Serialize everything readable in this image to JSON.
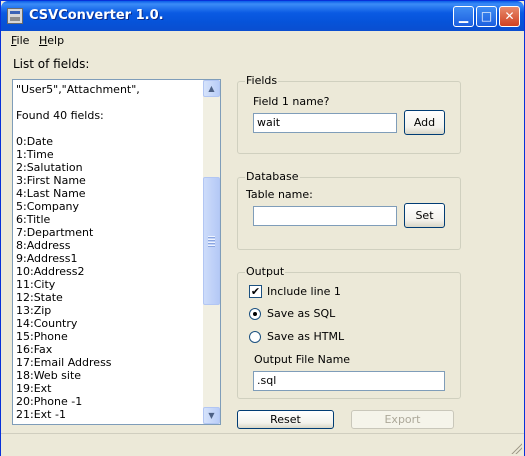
{
  "window": {
    "title": "CSVConverter 1.0."
  },
  "menu": [
    {
      "label": "File",
      "accel": "F",
      "rest": "ile"
    },
    {
      "label": "Help",
      "accel": "H",
      "rest": "elp"
    }
  ],
  "fields_list": {
    "label": "List of fields:",
    "lines": [
      "\"User5\",\"Attachment\",",
      "",
      "Found 40 fields:",
      "",
      "0:Date",
      "1:Time",
      "2:Salutation",
      "3:First Name",
      "4:Last Name",
      "5:Company",
      "6:Title",
      "7:Department",
      "8:Address",
      "9:Address1",
      "10:Address2",
      "11:City",
      "12:State",
      "13:Zip",
      "14:Country",
      "15:Phone",
      "16:Fax",
      "17:Email Address",
      "18:Web site",
      "19:Ext",
      "20:Phone -1",
      "21:Ext -1"
    ]
  },
  "fields_group": {
    "legend": "Fields",
    "prompt": "Field 1 name?",
    "input_value": "wait",
    "add_label": "Add"
  },
  "database_group": {
    "legend": "Database",
    "table_label": "Table name:",
    "table_value": "",
    "set_label": "Set"
  },
  "output_group": {
    "legend": "Output",
    "include_line1_label": "Include line 1",
    "include_line1_checked": true,
    "save_sql_label": "Save as SQL",
    "save_html_label": "Save as HTML",
    "selected_format": "SQL",
    "filename_label": "Output File Name",
    "filename_value": ".sql"
  },
  "buttons": {
    "reset_label": "Reset",
    "export_label": "Export"
  },
  "icons": {
    "minimize": "minimize-icon",
    "maximize": "maximize-icon",
    "close": "close-icon",
    "scroll_up": "scroll-up-arrow-icon",
    "scroll_down": "scroll-down-arrow-icon"
  }
}
